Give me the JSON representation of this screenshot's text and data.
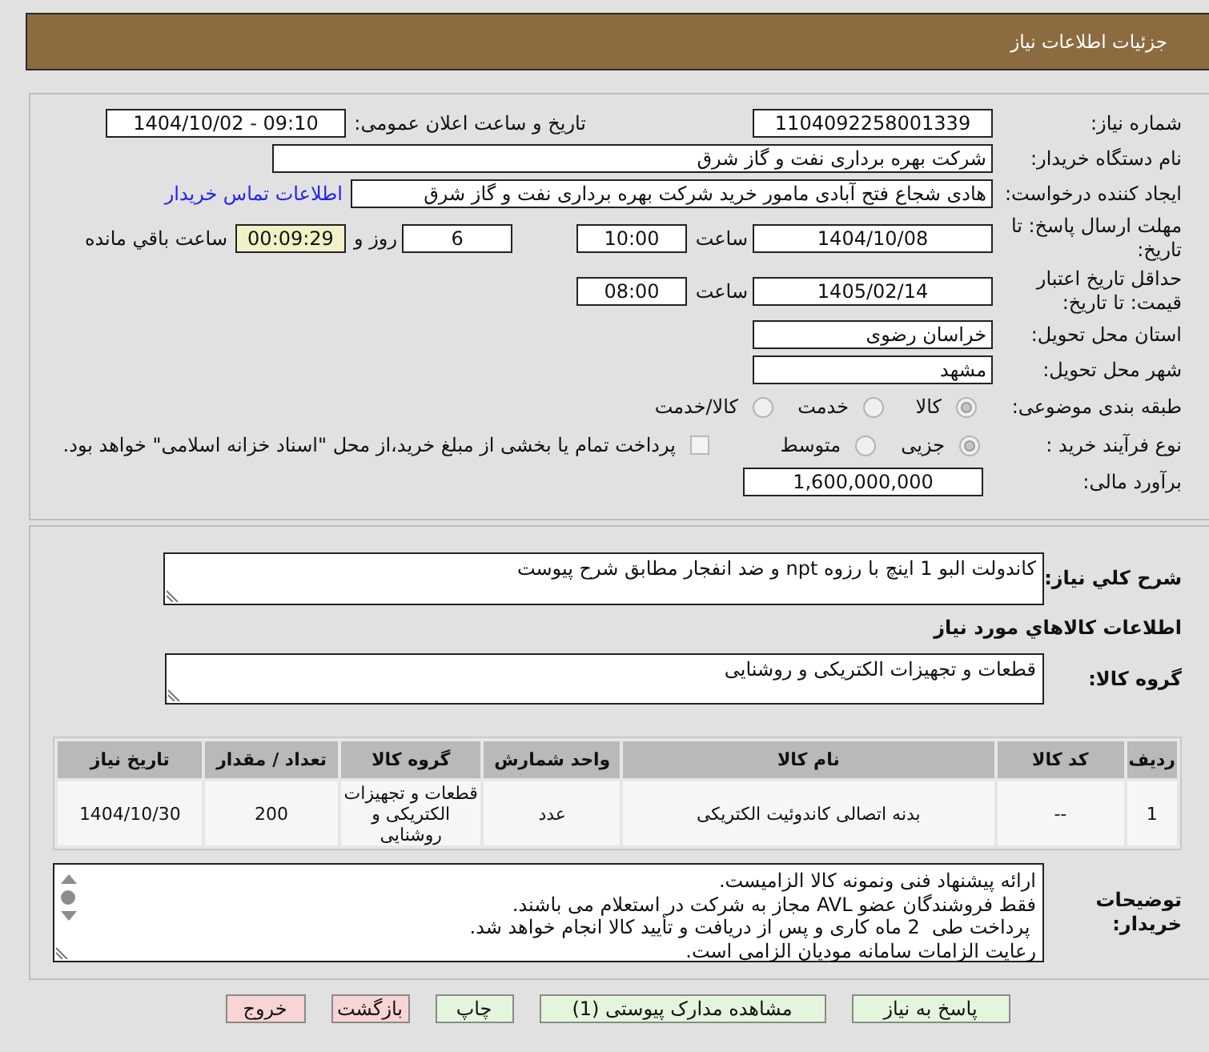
{
  "header": {
    "title": "جزئیات اطلاعات نیاز"
  },
  "form": {
    "need_number": {
      "label": "شماره نیاز:",
      "value": "1104092258001339"
    },
    "announcement": {
      "label": "تاریخ و ساعت اعلان عمومی:",
      "value": "1404/10/02 - 09:10"
    },
    "buyer_org": {
      "label": "نام دستگاه خریدار:",
      "value": "شرکت بهره برداری نفت و گاز شرق"
    },
    "requester": {
      "label": "ایجاد کننده درخواست:",
      "value": "هادی شجاع فتح آبادی مامور خرید شرکت بهره برداری نفت و گاز شرق",
      "link": "اطلاعات تماس خریدار"
    },
    "reply_deadline": {
      "label": "مهلت ارسال پاسخ: تا تاریخ:",
      "date": "1404/10/08",
      "time_label": "ساعت",
      "time": "10:00",
      "days": "6",
      "days_label": "روز و",
      "remaining": "00:09:29",
      "remaining_label": "ساعت باقي مانده"
    },
    "price_validity": {
      "label": "حداقل تاریخ اعتبار قیمت: تا تاریخ:",
      "date": "1405/02/14",
      "time_label": "ساعت",
      "time": "08:00"
    },
    "province": {
      "label": "استان محل تحویل:",
      "value": "خراسان رضوی"
    },
    "city": {
      "label": "شهر محل تحویل:",
      "value": "مشهد"
    },
    "category": {
      "label": "طبقه بندی موضوعی:",
      "options": [
        {
          "label": "کالا",
          "selected": true
        },
        {
          "label": "خدمت",
          "selected": false
        },
        {
          "label": "کالا/خدمت",
          "selected": false
        }
      ]
    },
    "process": {
      "label": "نوع فرآیند خرید :",
      "options": [
        {
          "label": "جزیی",
          "selected": true
        },
        {
          "label": "متوسط",
          "selected": false
        }
      ],
      "treasury": {
        "label": "پرداخت تمام یا بخشی از مبلغ خرید،از محل \"اسناد خزانه اسلامی\" خواهد بود.",
        "checked": false
      }
    },
    "estimate": {
      "label": "برآورد مالی:",
      "value": "1,600,000,000"
    }
  },
  "description": {
    "label": "شرح کلي نیاز:",
    "value": "کاندولت البو 1 اینچ با رزوه npt و ضد انفجار مطابق شرح پیوست"
  },
  "goods": {
    "heading": "اطلاعات کالاهاي مورد نیاز",
    "group_label": "گروه کالا:",
    "group_value": "قطعات و تجهیزات الکتریکی و روشنایی",
    "table": {
      "columns": [
        "ردیف",
        "کد کالا",
        "نام کالا",
        "واحد شمارش",
        "گروه کالا",
        "تعداد / مقدار",
        "تاریخ نیاز"
      ],
      "rows": [
        [
          "1",
          "--",
          "بدنه اتصالی کاندوئیت الکتریکی",
          "عدد",
          "قطعات و تجهیزات الکتریکی و روشنایی",
          "200",
          "1404/10/30"
        ]
      ]
    }
  },
  "buyer_notes": {
    "label": "توضیحات خریدار:",
    "lines": [
      "ارائه پیشنهاد فنی ونمونه کالا الزامیست.",
      "فقط فروشندگان عضو AVL مجاز به شرکت در استعلام می باشند.",
      " پرداخت طی  2 ماه کاری و پس از دریافت و تأیید کالا انجام خواهد شد.",
      "رعایت الزامات سامانه مودیان الزامی است."
    ]
  },
  "buttons": [
    {
      "label": "پاسخ به نیاز",
      "kind": "action"
    },
    {
      "label": "مشاهده مدارک پیوستی (1)",
      "kind": "action"
    },
    {
      "label": "چاپ",
      "kind": "action"
    },
    {
      "label": "بازگشت",
      "kind": "leave"
    },
    {
      "label": "خروج",
      "kind": "leave"
    }
  ]
}
